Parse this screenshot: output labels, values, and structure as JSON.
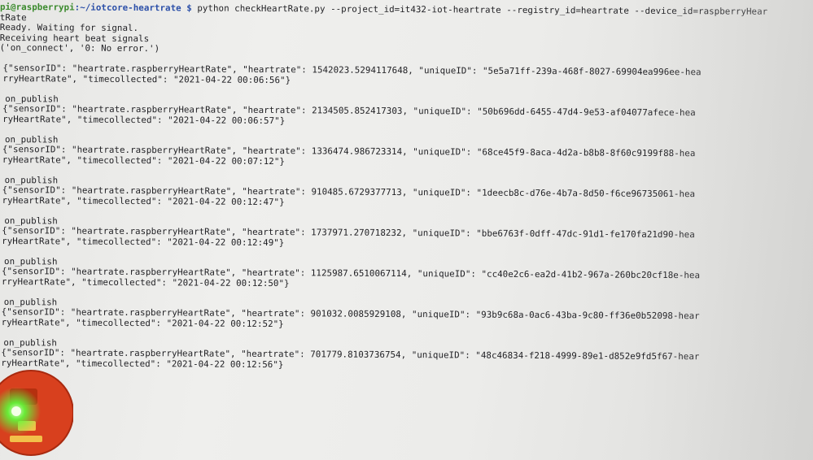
{
  "terminal": {
    "prompt": {
      "user_host": "pi@raspberrypi",
      "path": ":~/iotcore-heartrate $ ",
      "command": "python checkHeartRate.py --project_id=it432-iot-heartrate --registry_id=heartrate --device_id=raspberryHear",
      "command_wrap": "tRate"
    },
    "status_lines": [
      "Ready. Waiting for signal.",
      "Receiving heart beat signals",
      "('on_connect', '0: No error.')"
    ],
    "entries": [
      {
        "publish": "",
        "line1": "{\"sensorID\": \"heartrate.raspberryHeartRate\", \"heartrate\": 1542023.5294117648, \"uniqueID\": \"5e5a71ff-239a-468f-8027-69904ea996ee-hea",
        "line2": "rryHeartRate\", \"timecollected\": \"2021-04-22 00:06:56\"}"
      },
      {
        "publish": "on_publish",
        "line1": "{\"sensorID\": \"heartrate.raspberryHeartRate\", \"heartrate\": 2134505.852417303, \"uniqueID\": \"50b696dd-6455-47d4-9e53-af04077afece-hea",
        "line2": "ryHeartRate\", \"timecollected\": \"2021-04-22 00:06:57\"}"
      },
      {
        "publish": "on_publish",
        "line1": "{\"sensorID\": \"heartrate.raspberryHeartRate\", \"heartrate\": 1336474.986723314, \"uniqueID\": \"68ce45f9-8aca-4d2a-b8b8-8f60c9199f88-hea",
        "line2": "ryHeartRate\", \"timecollected\": \"2021-04-22 00:07:12\"}"
      },
      {
        "publish": "on_publish",
        "line1": "{\"sensorID\": \"heartrate.raspberryHeartRate\", \"heartrate\": 910485.6729377713, \"uniqueID\": \"1deecb8c-d76e-4b7a-8d50-f6ce96735061-hea",
        "line2": "ryHeartRate\", \"timecollected\": \"2021-04-22 00:12:47\"}"
      },
      {
        "publish": "on_publish",
        "line1": "{\"sensorID\": \"heartrate.raspberryHeartRate\", \"heartrate\": 1737971.270718232, \"uniqueID\": \"bbe6763f-0dff-47dc-91d1-fe170fa21d90-hea",
        "line2": "ryHeartRate\", \"timecollected\": \"2021-04-22 00:12:49\"}"
      },
      {
        "publish": "on_publish",
        "line1": "{\"sensorID\": \"heartrate.raspberryHeartRate\", \"heartrate\": 1125987.6510067114, \"uniqueID\": \"cc40e2c6-ea2d-41b2-967a-260bc20cf18e-hea",
        "line2": "rryHeartRate\", \"timecollected\": \"2021-04-22 00:12:50\"}"
      },
      {
        "publish": "on_publish",
        "line1": "{\"sensorID\": \"heartrate.raspberryHeartRate\", \"heartrate\": 901032.0085929108, \"uniqueID\": \"93b9c68a-0ac6-43ba-9c80-ff36e0b52098-hear",
        "line2": "ryHeartRate\", \"timecollected\": \"2021-04-22 00:12:52\"}"
      },
      {
        "publish": "on_publish",
        "line1": "{\"sensorID\": \"heartrate.raspberryHeartRate\", \"heartrate\": 701779.8103736754, \"uniqueID\": \"48c46834-f218-4999-89e1-d852e9fd5f67-hear",
        "line2": "ryHeartRate\", \"timecollected\": \"2021-04-22 00:12:56\"}"
      }
    ]
  },
  "colors": {
    "text": "#1e1e22",
    "prompt_user": "#3a8a2c",
    "prompt_path": "#2b4fa8",
    "background": "#ececea",
    "sensor_board": "#d8401e",
    "sensor_led": "#5cff3a"
  },
  "icons": {
    "pulse_sensor": "heart-rate-sensor-icon"
  }
}
